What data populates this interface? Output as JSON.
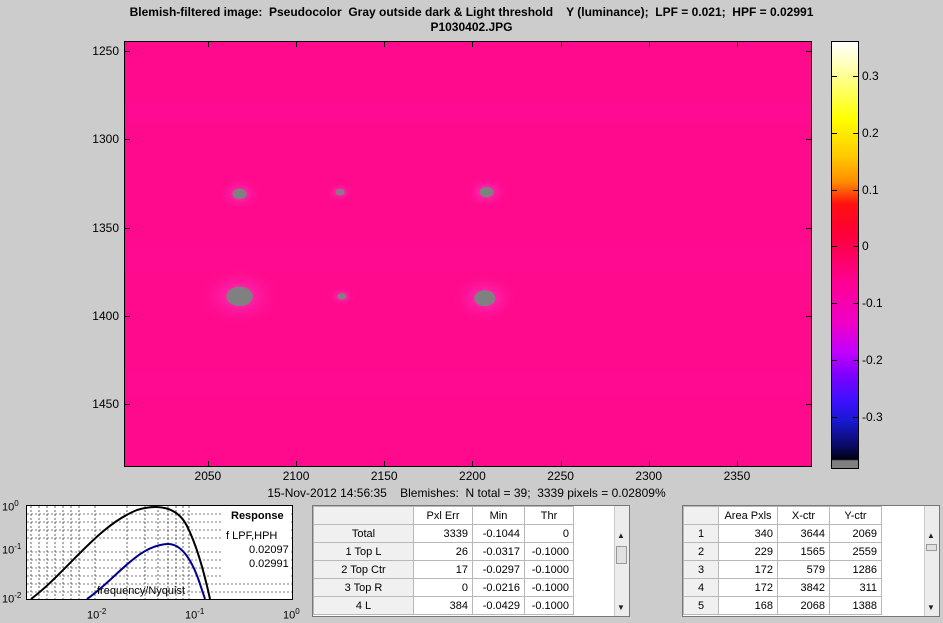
{
  "header": {
    "title_line1": "Blemish-filtered image:  Pseudocolor  Gray outside dark & Light threshold    Y (luminance);  LPF = 0.021;  HPF = 0.02991",
    "title_line2": "P1030402.JPG"
  },
  "main_plot": {
    "y_ticks": [
      "1250",
      "1300",
      "1350",
      "1400",
      "1450"
    ],
    "x_ticks": [
      "2050",
      "2100",
      "2150",
      "2200",
      "2250",
      "2300",
      "2350"
    ],
    "y_range": [
      1245,
      1485
    ],
    "x_range": [
      2003,
      2392
    ],
    "blemishes": [
      {
        "x": 2068,
        "y": 1331,
        "rx": 4,
        "ry": 3
      },
      {
        "x": 2125,
        "y": 1330,
        "rx": 2.5,
        "ry": 1.8
      },
      {
        "x": 2208,
        "y": 1330,
        "rx": 4,
        "ry": 3
      },
      {
        "x": 2068,
        "y": 1389,
        "rx": 7.5,
        "ry": 5.5
      },
      {
        "x": 2126,
        "y": 1389,
        "rx": 2.5,
        "ry": 1.8
      },
      {
        "x": 2207,
        "y": 1390,
        "rx": 6,
        "ry": 4.5
      }
    ],
    "colors": {
      "background": "#ff0a8c",
      "blemish": "#808080"
    }
  },
  "colorbar": {
    "ticks": [
      "0.3",
      "0.2",
      "0.1",
      "0",
      "-0.1",
      "-0.2",
      "-0.3"
    ],
    "tick_values": [
      0.3,
      0.2,
      0.1,
      0,
      -0.1,
      -0.2,
      -0.3
    ],
    "range": [
      -0.39,
      0.36
    ]
  },
  "caption": "15-Nov-2012 14:56:35    Blemishes:  N total = 39;  3339 pixels = 0.02809%",
  "response_plot": {
    "y_ticks": [
      "10",
      "10",
      "10"
    ],
    "y_exps": [
      "0",
      "-1",
      "-2"
    ],
    "x_ticks": [
      "10",
      "10",
      "10"
    ],
    "x_exps": [
      "-2",
      "-1",
      "0"
    ],
    "legend_title": "Response",
    "legend_label": "f LPF,HPH",
    "lpf_value": "0.02097",
    "hpf_value": "0.02991",
    "xlabel": "frequency/Nyquist",
    "colors": {
      "curve1": "#000000",
      "curve2": "#00008b"
    }
  },
  "summary_table": {
    "headers": [
      "Pxl Err",
      "Min",
      "Thr"
    ],
    "rows": [
      {
        "label": "Total",
        "cells": [
          "3339",
          "-0.1044",
          "0"
        ]
      },
      {
        "label": "1 Top L",
        "cells": [
          "26",
          "-0.0317",
          "-0.1000"
        ]
      },
      {
        "label": "2 Top Ctr",
        "cells": [
          "17",
          "-0.0297",
          "-0.1000"
        ]
      },
      {
        "label": "3 Top R",
        "cells": [
          "0",
          "-0.0216",
          "-0.1000"
        ]
      },
      {
        "label": "4 L",
        "cells": [
          "384",
          "-0.0429",
          "-0.1000"
        ]
      }
    ]
  },
  "blemish_table": {
    "headers": [
      "Area Pxls",
      "X-ctr",
      "Y-ctr"
    ],
    "rows": [
      {
        "label": "1",
        "cells": [
          "340",
          "3644",
          "2069"
        ]
      },
      {
        "label": "2",
        "cells": [
          "229",
          "1565",
          "2559"
        ]
      },
      {
        "label": "3",
        "cells": [
          "172",
          "579",
          "1286"
        ]
      },
      {
        "label": "4",
        "cells": [
          "172",
          "3842",
          "311"
        ]
      },
      {
        "label": "5",
        "cells": [
          "168",
          "2068",
          "1388"
        ]
      }
    ]
  }
}
